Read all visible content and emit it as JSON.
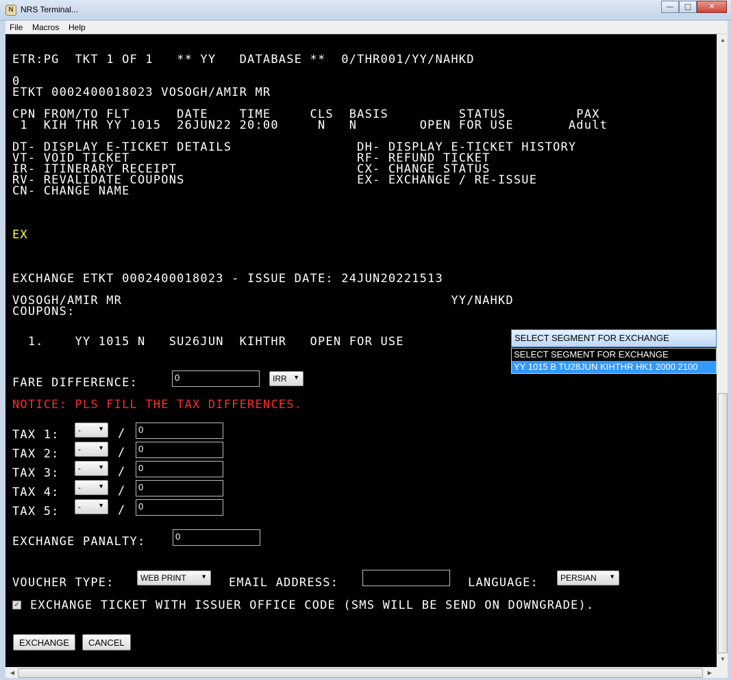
{
  "window": {
    "title": "NRS Terminal...",
    "app_icon": "N"
  },
  "menu": {
    "file": "File",
    "macros": "Macros",
    "help": "Help"
  },
  "terminal": {
    "lines": {
      "l1": "ETR:PG  TKT 1 OF 1   ** YY   DATABASE **  0/THR001/YY/NAHKD",
      "l2": "0",
      "l3": "ETKT 0002400018023 VOSOGH/AMIR MR",
      "l4": "CPN FROM/TO FLT      DATE    TIME     CLS  BASIS         STATUS         PAX",
      "l5": " 1  KIH THR YY 1015  26JUN22 20:00     N   N        OPEN FOR USE       Adult",
      "l6": "DT- DISPLAY E-TICKET DETAILS                DH- DISPLAY E-TICKET HISTORY",
      "l7": "VT- VOID TICKET                             RF- REFUND TICKET",
      "l8": "IR- ITINERARY RECEIPT                       CX- CHANGE STATUS",
      "l9": "RV- REVALIDATE COUPONS                      EX- EXCHANGE / RE-ISSUE",
      "l10": "CN- CHANGE NAME",
      "cmd": "EX",
      "l11": "EXCHANGE ETKT 0002400018023 - ISSUE DATE: 24JUN20221513",
      "l12": "VOSOGH/AMIR MR                                          YY/NAHKD",
      "l13": "COUPONS:",
      "coupon": "  1.    YY 1015 N   SU26JUN  KIHTHR   OPEN FOR USE"
    },
    "segment_dropdown": {
      "selected": "SELECT SEGMENT FOR EXCHANGE",
      "options": [
        "SELECT SEGMENT FOR EXCHANGE",
        "YY 1015 B TU28JUN KIHTHR HK1 2000 2100"
      ]
    },
    "fare": {
      "label": "FARE DIFFERENCE:",
      "value": "0",
      "currency": "IRR"
    },
    "notice": "NOTICE: PLS FILL THE TAX DIFFERENCES.",
    "taxes": [
      {
        "label": "TAX 1:",
        "type": "-",
        "value": "0"
      },
      {
        "label": "TAX 2:",
        "type": "-",
        "value": "0"
      },
      {
        "label": "TAX 3:",
        "type": "-",
        "value": "0"
      },
      {
        "label": "TAX 4:",
        "type": "-",
        "value": "0"
      },
      {
        "label": "TAX 5:",
        "type": "-",
        "value": "0"
      }
    ],
    "tax_separator": "/",
    "penalty": {
      "label": "EXCHANGE PANALTY:",
      "value": "0"
    },
    "voucher": {
      "label": "VOUCHER TYPE:",
      "value": "WEB PRINT"
    },
    "email": {
      "label": "EMAIL ADDRESS:",
      "value": ""
    },
    "language": {
      "label": "LANGUAGE:",
      "value": "PERSIAN"
    },
    "issuer_checkbox": {
      "label": "EXCHANGE TICKET WITH ISSUER OFFICE CODE (SMS WILL BE SEND ON DOWNGRADE).",
      "checked": true
    },
    "buttons": {
      "exchange": "EXCHANGE",
      "cancel": "CANCEL"
    }
  }
}
